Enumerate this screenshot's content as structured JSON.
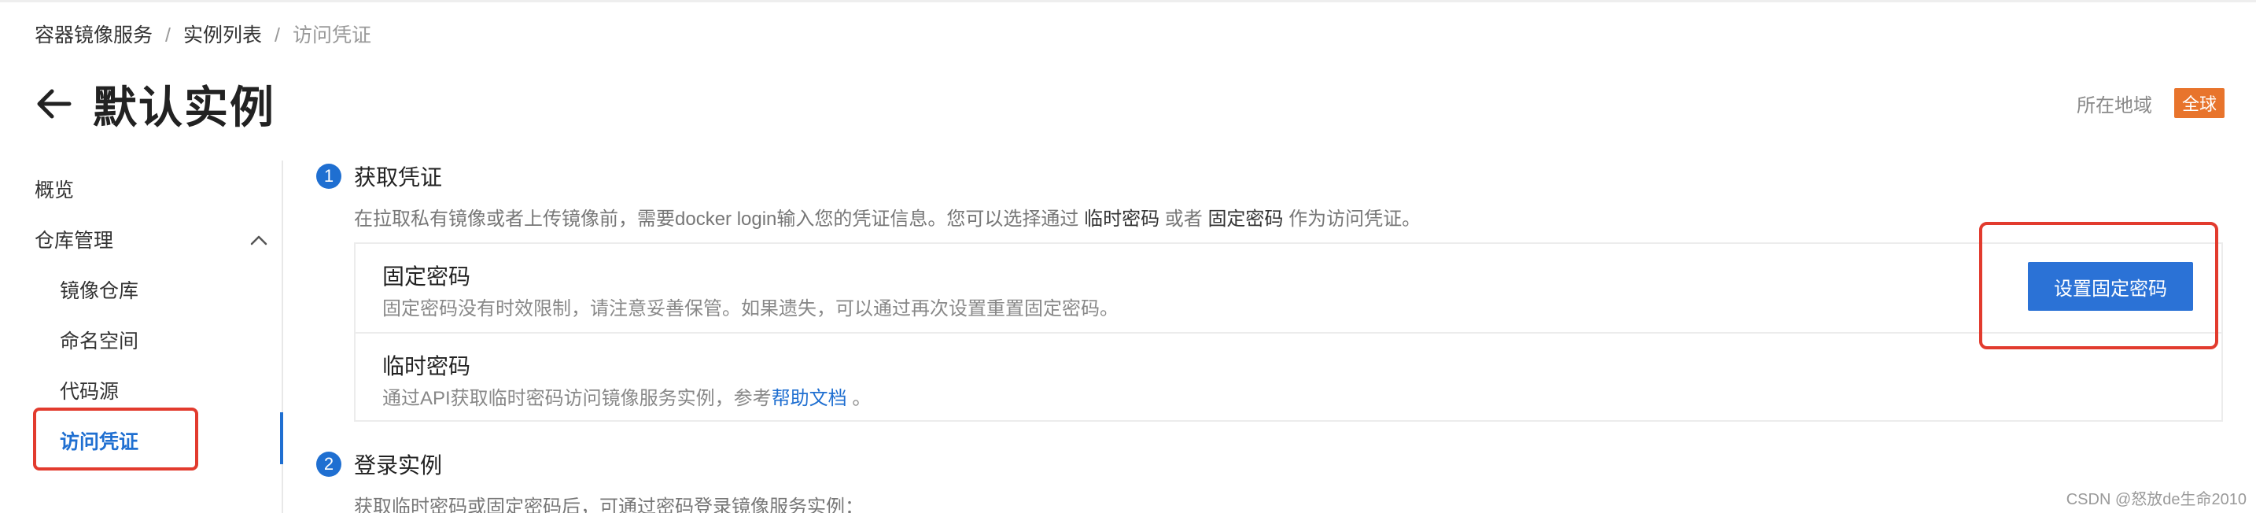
{
  "breadcrumb": {
    "items": [
      "容器镜像服务",
      "实例列表",
      "访问凭证"
    ],
    "separator": "/"
  },
  "header": {
    "back_icon": "arrow-left-icon",
    "title": "默认实例"
  },
  "region": {
    "label": "所在地域",
    "badge": "全球",
    "badge_color": "#e8742c"
  },
  "sidebar": {
    "overview": "概览",
    "repo_group": {
      "label": "仓库管理",
      "icon": "chevron-up-icon",
      "items": [
        "镜像仓库",
        "命名空间",
        "代码源"
      ]
    },
    "active_item": "访问凭证"
  },
  "steps": {
    "step1": {
      "number": "1",
      "title": "获取凭证",
      "desc_prefix": "在拉取私有镜像或者上传镜像前，需要docker login输入您的凭证信息。您可以选择通过",
      "desc_opt1": "临时密码",
      "desc_mid": "或者",
      "desc_opt2": "固定密码",
      "desc_suffix": "作为访问凭证。"
    },
    "step2": {
      "number": "2",
      "title": "登录实例",
      "desc": "获取临时密码或固定密码后，可通过密码登录镜像服务实例："
    }
  },
  "fixed_password": {
    "title": "固定密码",
    "desc": "固定密码没有时效限制，请注意妥善保管。如果遗失，可以通过再次设置重置固定密码。",
    "button": "设置固定密码"
  },
  "temp_password": {
    "title": "临时密码",
    "desc_prefix": "通过API获取临时密码访问镜像服务实例，参考",
    "link": "帮助文档",
    "desc_suffix": "。"
  },
  "watermark": "CSDN @怒放de生命2010",
  "colors": {
    "accent": "#1f6fd1",
    "highlight": "#e23b2e"
  }
}
